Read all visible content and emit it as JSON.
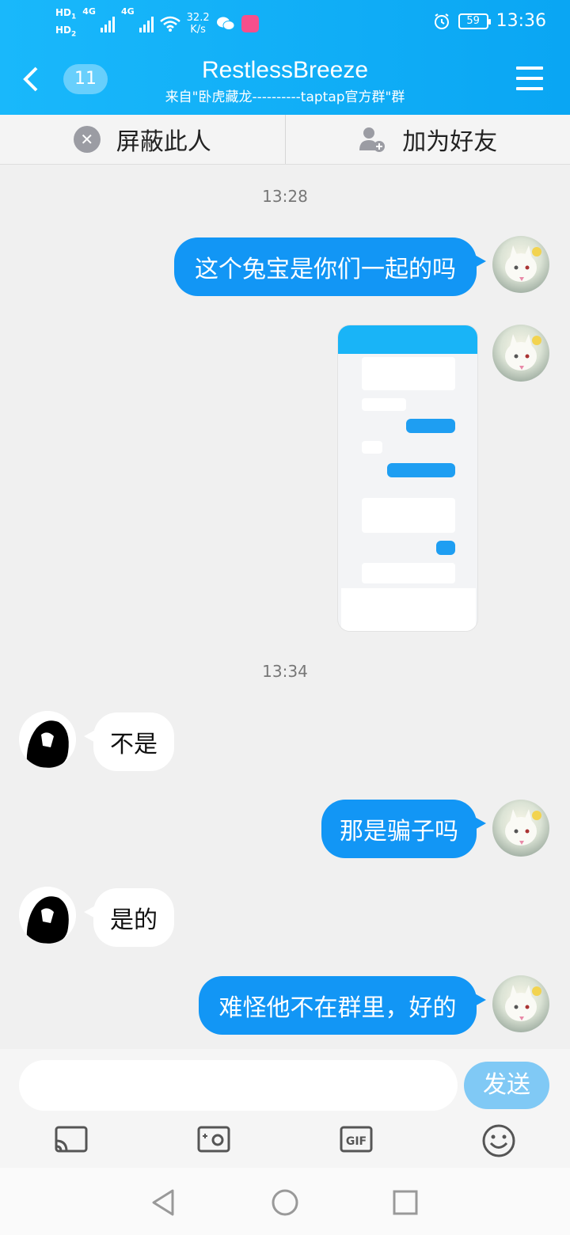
{
  "status_bar": {
    "sim1": "HD",
    "sim1_num": "1",
    "sim2": "HD",
    "sim2_num": "2",
    "network1": "4G",
    "network2": "4G",
    "speed_value": "32.2",
    "speed_unit": "K/s",
    "battery": "59",
    "time": "13:36"
  },
  "header": {
    "unread_count": "11",
    "title": "RestlessBreeze",
    "subtitle": "来自\"卧虎藏龙----------taptap官方群\"群"
  },
  "actions": {
    "block_label": "屏蔽此人",
    "add_friend_label": "加为好友"
  },
  "messages": {
    "time1": "13:28",
    "m1": "这个兔宝是你们一起的吗",
    "time2": "13:34",
    "m2": "不是",
    "m3": "那是骗子吗",
    "m4": "是的",
    "m5": "难怪他不在群里，好的"
  },
  "input": {
    "placeholder": "",
    "send_label": "发送"
  },
  "colors": {
    "header_gradient_start": "#19b8fb",
    "header_gradient_end": "#0aa6f3",
    "outgoing_bubble": "#1296f5",
    "send_button": "#80c9f5"
  }
}
